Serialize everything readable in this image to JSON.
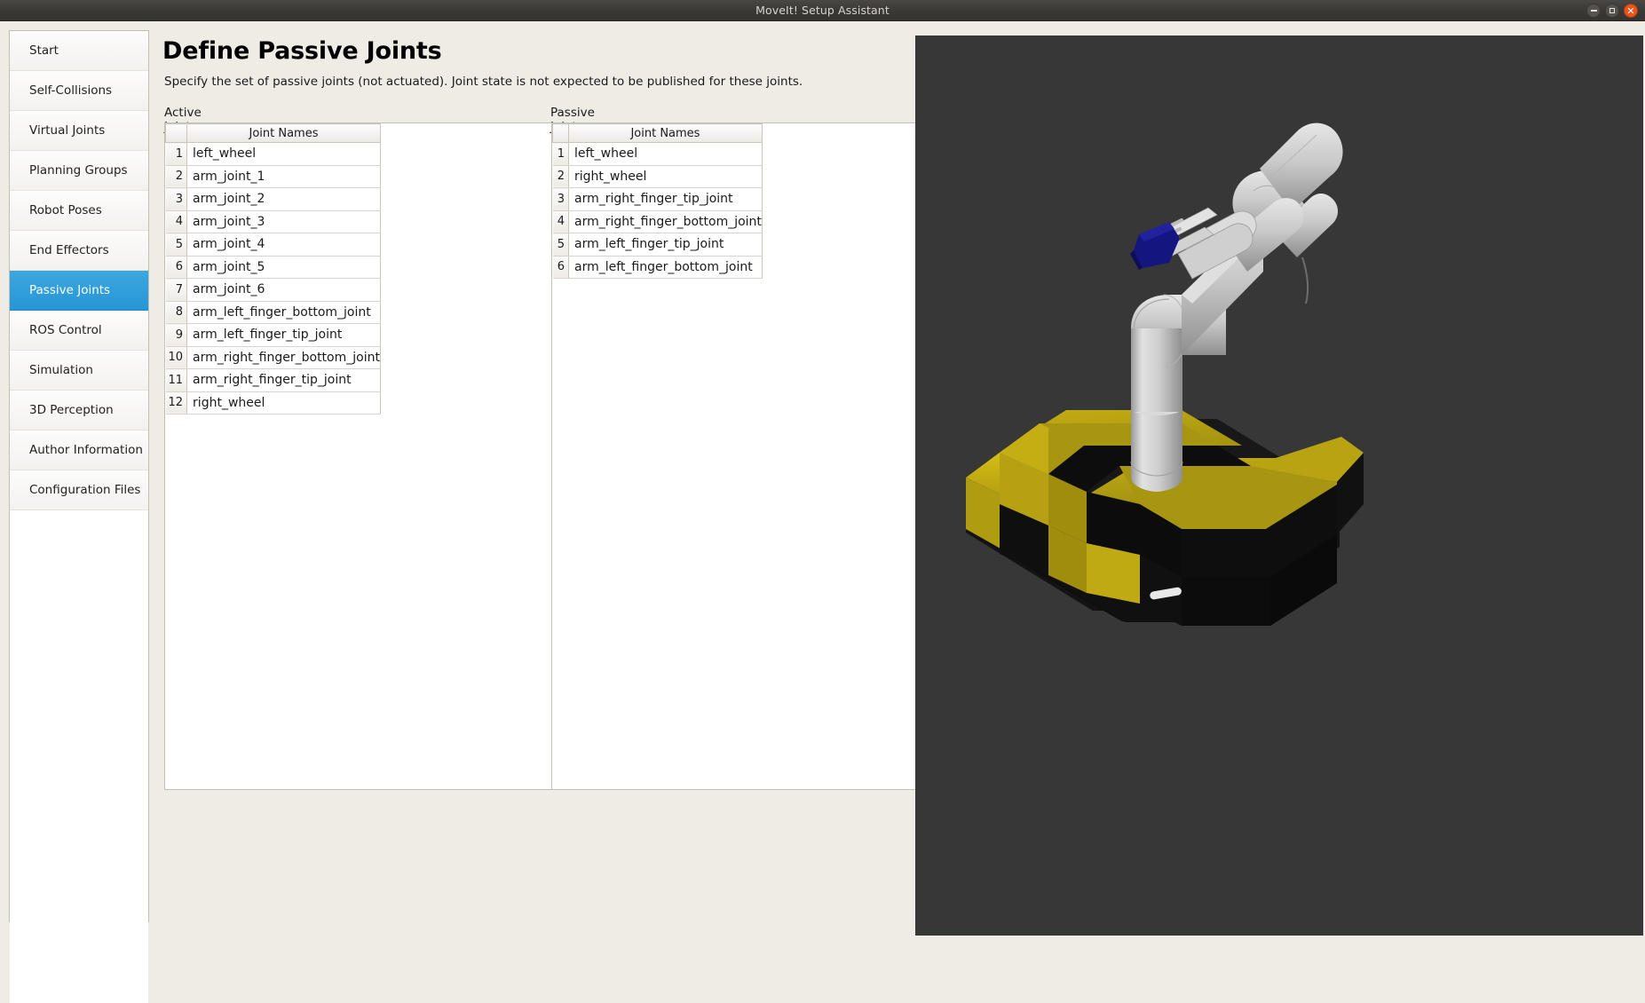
{
  "window": {
    "title": "MoveIt! Setup Assistant",
    "controls": [
      {
        "name": "minimize",
        "glyph": "–"
      },
      {
        "name": "maximize",
        "glyph": "□"
      },
      {
        "name": "close",
        "glyph": "✕"
      }
    ]
  },
  "sidebar": {
    "items": [
      {
        "label": "Start",
        "selected": false
      },
      {
        "label": "Self-Collisions",
        "selected": false
      },
      {
        "label": "Virtual Joints",
        "selected": false
      },
      {
        "label": "Planning Groups",
        "selected": false
      },
      {
        "label": "Robot Poses",
        "selected": false
      },
      {
        "label": "End Effectors",
        "selected": false
      },
      {
        "label": "Passive Joints",
        "selected": true
      },
      {
        "label": "ROS Control",
        "selected": false
      },
      {
        "label": "Simulation",
        "selected": false
      },
      {
        "label": "3D Perception",
        "selected": false
      },
      {
        "label": "Author Information",
        "selected": false
      },
      {
        "label": "Configuration Files",
        "selected": false
      }
    ]
  },
  "page": {
    "title": "Define Passive Joints",
    "subtitle": "Specify the set of passive joints (not actuated). Joint state is not expected to be published for these joints."
  },
  "active_joints": {
    "label": "Active Joints",
    "column_header": "Joint Names",
    "rows": [
      "left_wheel",
      "arm_joint_1",
      "arm_joint_2",
      "arm_joint_3",
      "arm_joint_4",
      "arm_joint_5",
      "arm_joint_6",
      "arm_left_finger_bottom_joint",
      "arm_left_finger_tip_joint",
      "arm_right_finger_bottom_joint",
      "arm_right_finger_tip_joint",
      "right_wheel"
    ]
  },
  "passive_joints": {
    "label": "Passive Joints",
    "column_header": "Joint Names",
    "rows": [
      "left_wheel",
      "right_wheel",
      "arm_right_finger_tip_joint",
      "arm_right_finger_bottom_joint",
      "arm_left_finger_tip_joint",
      "arm_left_finger_bottom_joint"
    ]
  },
  "transfer": {
    "to_passive_label": ">",
    "to_active_label": "<"
  },
  "viewport": {
    "background_color": "#373737",
    "robot_body_color": "#c8c8c8",
    "base_top_color": "#b3a012",
    "base_dark_color": "#121212",
    "gripper_object_color": "#1a1a8c"
  }
}
